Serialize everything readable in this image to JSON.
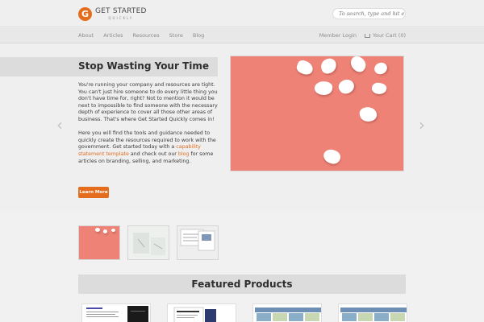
{
  "header": {
    "logo_letter": "G",
    "logo_main": "GET STARTED",
    "logo_sub": "QUICKLY",
    "search_placeholder": "To search, type and hit enter"
  },
  "nav": {
    "left": [
      "About",
      "Articles",
      "Resources",
      "Store",
      "Blog"
    ],
    "member_login": "Member Login",
    "cart": "Your Cart (0)"
  },
  "hero": {
    "title": "Stop Wasting Your Time",
    "paragraph1": "You're running your company and resources are tight. You can't just hire someone to do every little thing you don't have time for, right? Not to mention it would be next to impossible to find someone with the necessary depth of experience to cover all those other areas of business. That's where Get Started Quickly comes in!",
    "p2_part1": "Here you will find the tools and guidance needed to quickly create the resources required to work with the government. Get started today with a ",
    "p2_link1": "capability statement template",
    "p2_part2": " and check out our ",
    "p2_link2": "blog",
    "p2_part3": " for some articles on branding, selling, and marketing.",
    "button": "Learn More",
    "arrow_left": "‹",
    "arrow_right": "›"
  },
  "featured": {
    "title": "Featured Products"
  },
  "colors": {
    "accent": "#e36c1d",
    "hero_image_bg": "#ee8277"
  }
}
